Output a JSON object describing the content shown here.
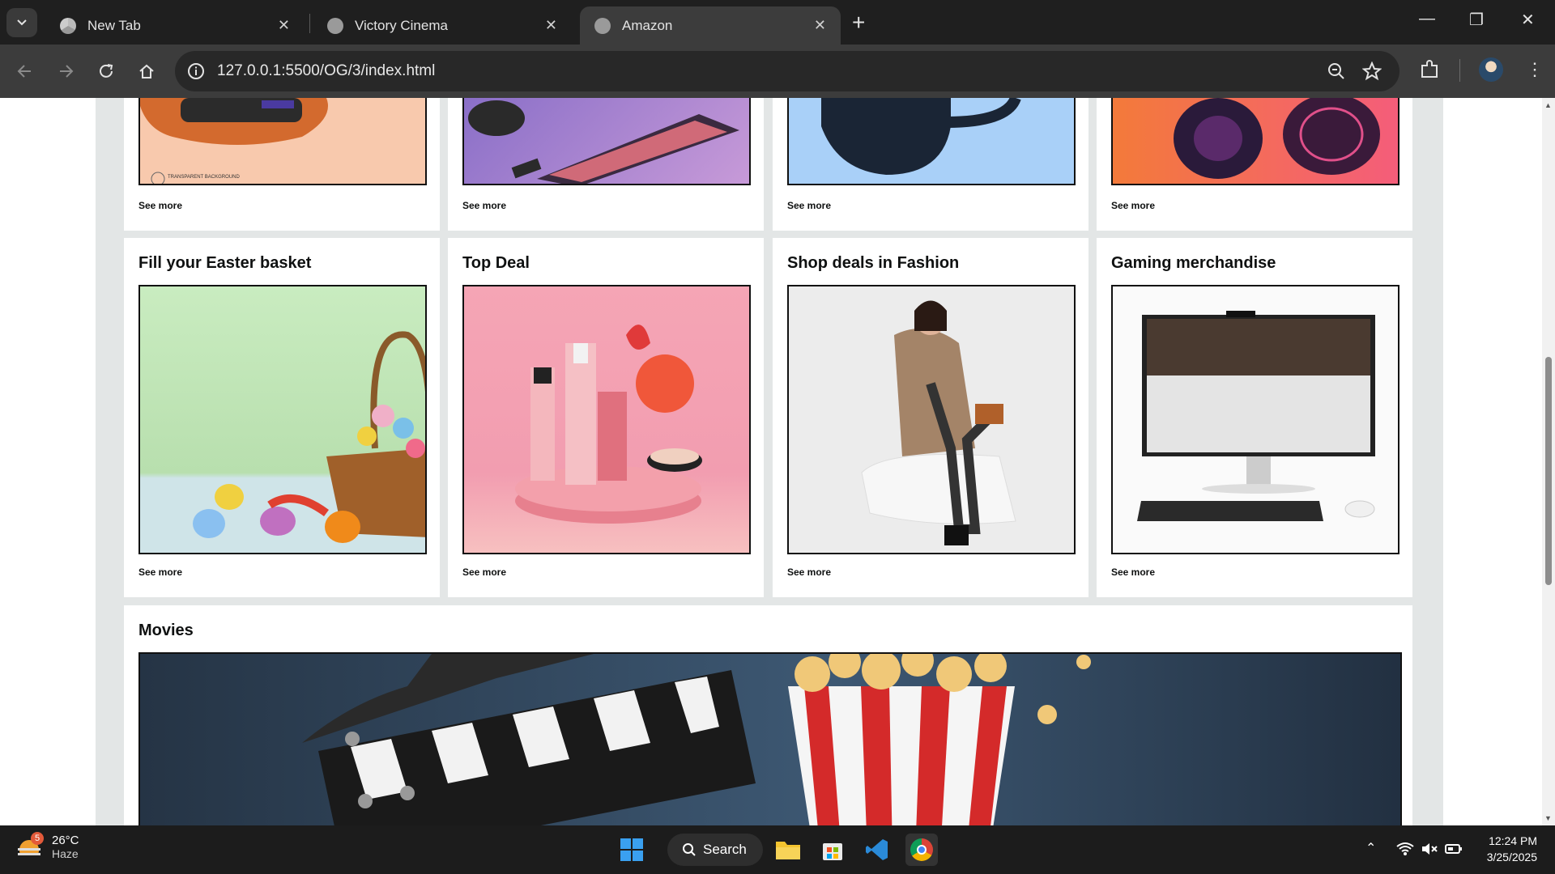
{
  "browser": {
    "tabs": [
      {
        "title": "New Tab",
        "active": false
      },
      {
        "title": "Victory Cinema",
        "active": false
      },
      {
        "title": "Amazon",
        "active": true
      }
    ],
    "url": "127.0.0.1:5500/OG/3/index.html"
  },
  "page": {
    "top_row_links": [
      "See more",
      "See more",
      "See more",
      "See more"
    ],
    "cards": [
      {
        "title": "Fill your Easter basket",
        "link": "See more"
      },
      {
        "title": "Top Deal",
        "link": "See more"
      },
      {
        "title": "Shop deals in Fashion",
        "link": "See more"
      },
      {
        "title": "Gaming merchandise",
        "link": "See more"
      }
    ],
    "movies": {
      "title": "Movies"
    },
    "transparent_bg_label": "TRANSPARENT BACKGROUND"
  },
  "taskbar": {
    "weather": {
      "temp": "26°C",
      "condition": "Haze",
      "badge": "5"
    },
    "search_label": "Search",
    "time": "12:24 PM",
    "date": "3/25/2025"
  },
  "colors": {
    "accent_orange": "#f0c14b",
    "page_bg": "#e3e6e6"
  }
}
